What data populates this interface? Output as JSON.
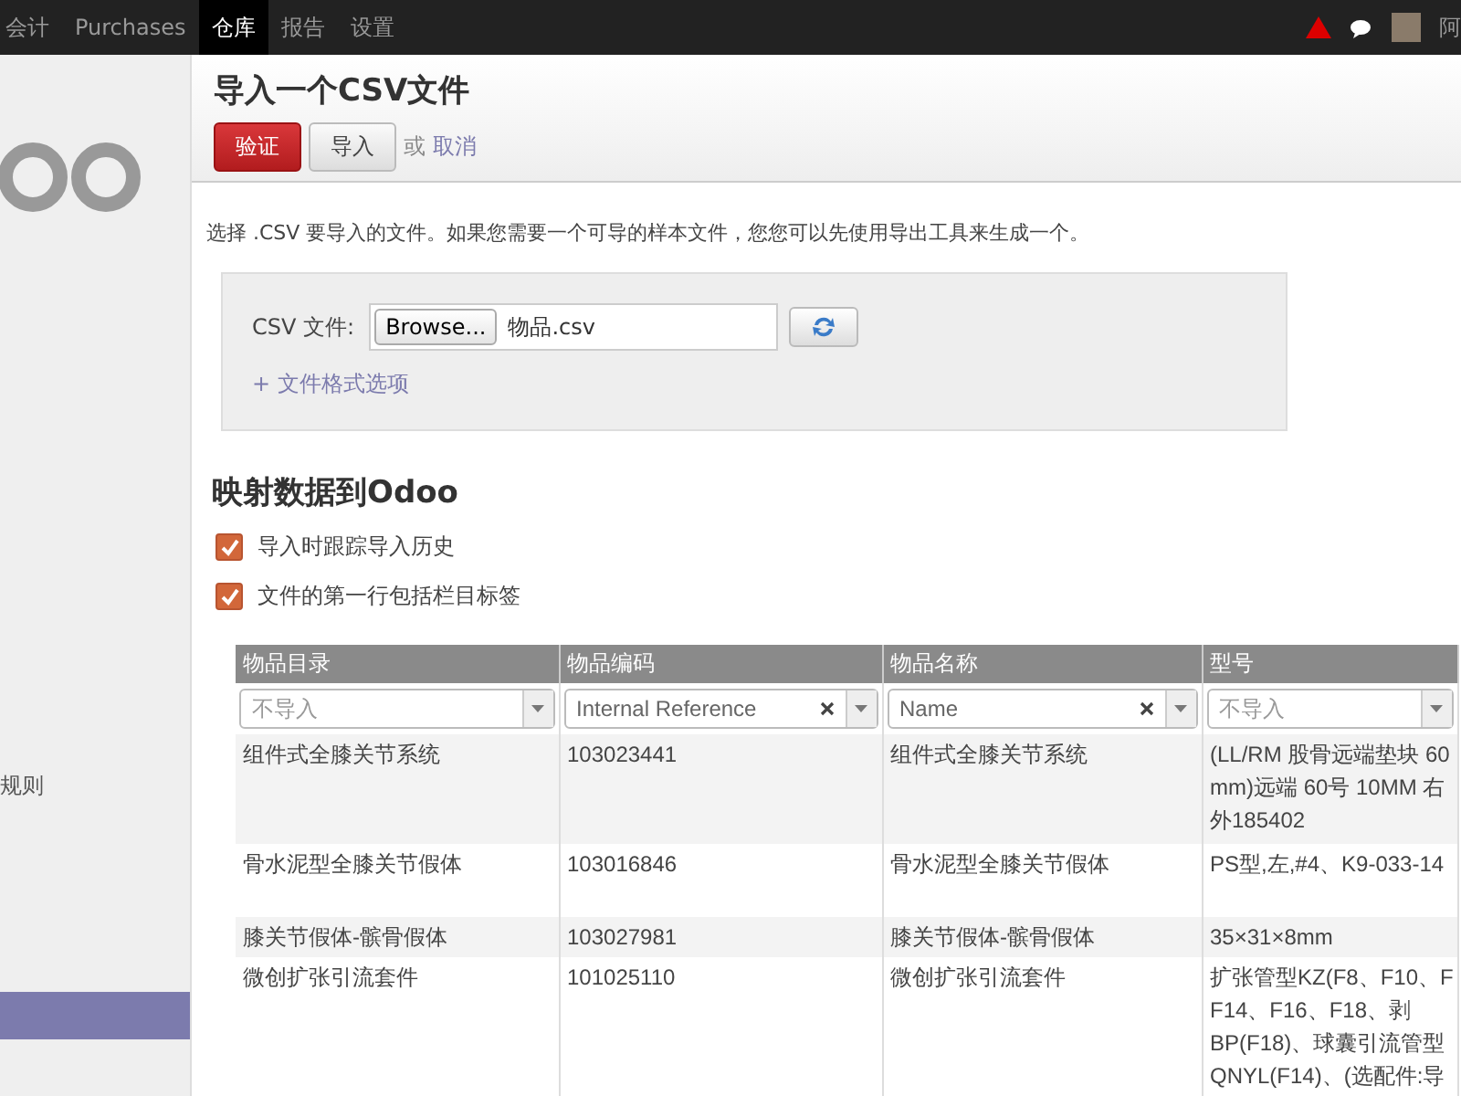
{
  "top_menu": [
    {
      "label": "会计",
      "selected": false
    },
    {
      "label": "Purchases",
      "selected": false
    },
    {
      "label": "仓库",
      "selected": true
    },
    {
      "label": "报告",
      "selected": false
    },
    {
      "label": "设置",
      "selected": false
    }
  ],
  "user": {
    "name": "阿"
  },
  "sidebar": {
    "items": [
      {
        "label": "规则",
        "selected": false
      },
      {
        "selected": true
      }
    ]
  },
  "header": {
    "title": "导入一个CSV文件",
    "buttons": [
      {
        "label": "验证",
        "kind": "primary"
      },
      {
        "label": "导入",
        "kind": "default"
      }
    ],
    "or": "或",
    "cancel": "取消"
  },
  "description": "选择 .CSV 要导入的文件。如果您需要一个可导的样本文件，您您可以先使用导出工具来生成一个。",
  "file_box": {
    "label": "CSV 文件:",
    "browse": "Browse...",
    "file_name": "物品.csv",
    "options_link": "+ 文件格式选项"
  },
  "mapping": {
    "title": "映射数据到Odoo",
    "options": [
      {
        "label": "导入时跟踪导入历史",
        "checked": true
      },
      {
        "label": "文件的第一行包括栏目标签",
        "checked": true
      }
    ]
  },
  "table": {
    "columns": [
      {
        "label": "物品目录",
        "field": {
          "placeholder": "不导入"
        }
      },
      {
        "label": "物品编码",
        "field": {
          "value": "Internal Reference"
        }
      },
      {
        "label": "物品名称",
        "field": {
          "value": "Name"
        }
      },
      {
        "label": "型号",
        "field": {
          "placeholder": "不导入"
        }
      }
    ],
    "rows": [
      [
        "组件式全膝关节系统",
        "103023441",
        "组件式全膝关节系统",
        [
          "(LL/RM 股骨远端垫块 60",
          "mm)远端 60号 10MM 右",
          "外185402"
        ]
      ],
      [
        "骨水泥型全膝关节假体",
        "103016846",
        "骨水泥型全膝关节假体",
        [
          "PS型,左,#4、K9-033-14"
        ]
      ],
      [
        "膝关节假体-髌骨假体",
        "103027981",
        "膝关节假体-髌骨假体",
        [
          "35×31×8mm"
        ]
      ],
      [
        "微创扩张引流套件",
        "101025110",
        "微创扩张引流套件",
        [
          "扩张管型KZ(F8、F10、F",
          "F14、F16、F18、剥",
          "BP(F18)、球囊引流管型",
          "QNYL(F14)、(选配件:导"
        ]
      ]
    ]
  }
}
